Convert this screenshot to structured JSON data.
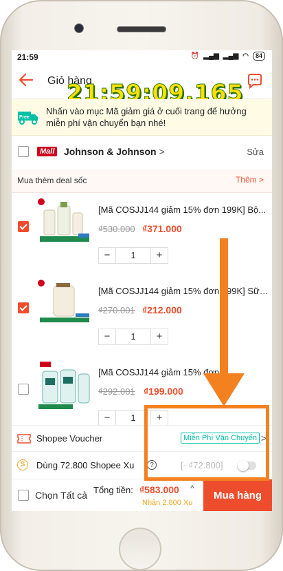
{
  "status_bar": {
    "time": "21:59",
    "battery": "84"
  },
  "header": {
    "title": "Giỏ hàng"
  },
  "overlay": {
    "timestamp": "21:59:09.165"
  },
  "banner": {
    "text": "Nhấn vào mục Mã giảm giá ở cuối trang để hưởng miễn phí vận chuyển bạn nhé!",
    "truck_label": "Free"
  },
  "shop": {
    "badge": "Mall",
    "name": "Johnson & Johnson",
    "chevron": ">",
    "edit": "Sửa"
  },
  "deal": {
    "label": "Mua thêm deal sốc",
    "more": "Thêm >"
  },
  "items": [
    {
      "name": "[Mã COSJJ144 giảm 15% đơn 199K] Bộ...",
      "old_price": "₫530.000",
      "new_price": "₫371.000",
      "qty": "1",
      "checked": true
    },
    {
      "name": "[Mã COSJJ144 giảm 15% đơn 199K] Sữa...",
      "old_price": "₫270.001",
      "new_price": "₫212.000",
      "qty": "1",
      "checked": true
    },
    {
      "name": "[Mã COSJJ144 giảm 15% đơn 1...",
      "old_price": "₫292.001",
      "new_price": "₫199.000",
      "qty": "1",
      "checked": false
    }
  ],
  "qty_controls": {
    "minus": "−",
    "plus": "+"
  },
  "voucher": {
    "label": "Shopee Voucher",
    "tag": "Miễn Phí Vận Chuyển",
    "chevron": ">"
  },
  "coins": {
    "icon": "S",
    "label": "Dùng 72.800 Shopee Xu",
    "help": "?",
    "discount": "[- ₫72.800]",
    "enabled": false
  },
  "footer": {
    "select_all": "Chọn Tất cả",
    "total_label": "Tổng tiền:",
    "total_value": "₫583.000",
    "caret": "^",
    "coins_earned": "Nhận 2.800 Xu",
    "checkout": "Mua hàng"
  },
  "colors": {
    "brand": "#ee4d2d",
    "annotation": "#f4811f",
    "free_ship": "#00bfa5",
    "coin": "#f5a623"
  }
}
